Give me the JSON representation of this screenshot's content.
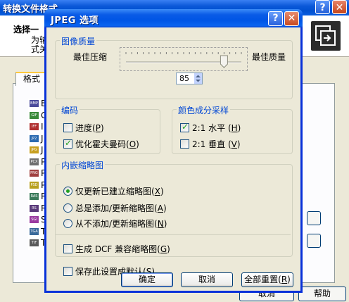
{
  "background_window": {
    "title": "转换文件格式",
    "help_button": "?",
    "close_button": "✕",
    "select_heading": "选择一",
    "description_line1": "为输",
    "description_line2": "式关",
    "tab_label": "格式",
    "formats": [
      {
        "icon": "BMP",
        "letter": "B",
        "color": "#4a4a9a"
      },
      {
        "icon": "GIF",
        "letter": "G",
        "color": "#3a8a3a"
      },
      {
        "icon": "IFF",
        "letter": "I",
        "color": "#b03030"
      },
      {
        "icon": "JP2",
        "letter": "J",
        "color": "#2a6ab0"
      },
      {
        "icon": "JPG",
        "letter": "J",
        "color": "#c8a020"
      },
      {
        "icon": "PCX",
        "letter": "P",
        "color": "#707070"
      },
      {
        "icon": "PNG",
        "letter": "P",
        "color": "#a04040"
      },
      {
        "icon": "PSD",
        "letter": "P",
        "color": "#b8a020"
      },
      {
        "icon": "RAS",
        "letter": "R",
        "color": "#3a7a5a"
      },
      {
        "icon": "RS",
        "letter": "R",
        "color": "#5a3a7a"
      },
      {
        "icon": "SGI",
        "letter": "S",
        "color": "#9a3aa0"
      },
      {
        "icon": "TGA",
        "letter": "T",
        "color": "#3a6a9a"
      },
      {
        "icon": "TIF",
        "letter": "T",
        "color": "#5a5a5a"
      }
    ],
    "help_bottom_button": "帮助",
    "partial_button": "取消"
  },
  "dialog": {
    "title": "JPEG 选项",
    "help_button": "?",
    "close_button": "✕",
    "image_quality": {
      "legend": "图像质量",
      "min_label": "最佳压缩",
      "max_label": "最佳质量",
      "value": "85",
      "slider_fraction": 0.85
    },
    "encoding": {
      "legend": "编码",
      "progressive": {
        "label": "进度",
        "hotkey": "P",
        "checked": false
      },
      "optimize": {
        "label": "优化霍夫曼码",
        "hotkey": "O",
        "checked": true
      }
    },
    "subsampling": {
      "legend": "颜色成分采样",
      "horizontal": {
        "label": "2:1 水平",
        "hotkey": "H",
        "checked": true
      },
      "vertical": {
        "label": "2:1 垂直",
        "hotkey": "V",
        "checked": false
      }
    },
    "thumbnail": {
      "legend": "内嵌缩略图",
      "options": [
        {
          "label": "仅更新已建立缩略图",
          "hotkey": "X",
          "selected": true
        },
        {
          "label": "总是添加/更新缩略图",
          "hotkey": "A",
          "selected": false
        },
        {
          "label": "从不添加/更新缩略图",
          "hotkey": "N",
          "selected": false
        }
      ],
      "dcf": {
        "label": "生成 DCF 兼容缩略图",
        "hotkey": "G",
        "checked": false
      }
    },
    "save_default": {
      "label": "保存此设置成默认",
      "hotkey": "S",
      "checked": false
    },
    "ok_button": "确定",
    "cancel_button": "取消",
    "reset_button": {
      "label": "全部重置",
      "hotkey": "R"
    }
  }
}
